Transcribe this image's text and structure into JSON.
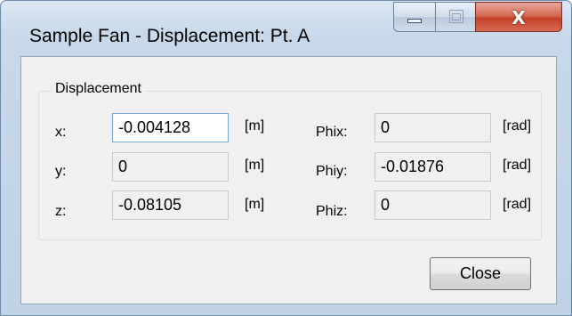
{
  "window": {
    "title": "Sample Fan - Displacement: Pt. A",
    "close_glyph": "X"
  },
  "icons": {
    "minimize": "minimize-icon",
    "maximize": "maximize-icon",
    "close": "close-icon"
  },
  "group": {
    "title": "Displacement"
  },
  "translations": [
    {
      "label": "x:",
      "value": "-0.004128",
      "unit": "[m]"
    },
    {
      "label": "y:",
      "value": "0",
      "unit": "[m]"
    },
    {
      "label": "z:",
      "value": "-0.08105",
      "unit": "[m]"
    }
  ],
  "rotations": [
    {
      "label": "Phix:",
      "value": "0",
      "unit": "[rad]"
    },
    {
      "label": "Phiy:",
      "value": "-0.01876",
      "unit": "[rad]"
    },
    {
      "label": "Phiz:",
      "value": "0",
      "unit": "[rad]"
    }
  ],
  "buttons": {
    "close_label": "Close"
  },
  "colors": {
    "titlebar": "#c7d8ea",
    "close_caption": "#c2402a",
    "client": "#f0f0f0"
  }
}
